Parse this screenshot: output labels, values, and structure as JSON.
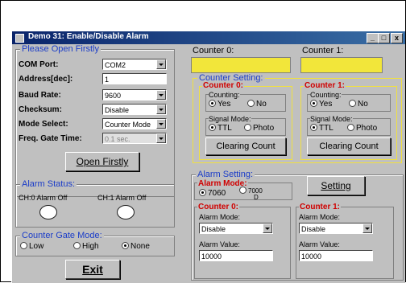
{
  "window": {
    "title": "Demo 31: Enable/Disable Alarm",
    "buttons": {
      "min": "_",
      "max": "□",
      "close": "x"
    }
  },
  "open_group": {
    "title": "Please Open Firstly",
    "com_port": {
      "label": "COM Port:",
      "value": "COM2"
    },
    "address": {
      "label": "Address[dec]:",
      "value": "1"
    },
    "baud_rate": {
      "label": "Baud Rate:",
      "value": "9600"
    },
    "checksum": {
      "label": "Checksum:",
      "value": "Disable"
    },
    "mode_select": {
      "label": "Mode Select:",
      "value": "Counter Mode"
    },
    "freq_gate": {
      "label": "Freq. Gate Time:",
      "value": "0.1 sec."
    },
    "open_button": "Open Firstly"
  },
  "alarm_status": {
    "title": "Alarm Status:",
    "ch0": "CH:0 Alarm Off",
    "ch1": "CH:1 Alarm Off"
  },
  "gate_mode": {
    "title": "Counter Gate Mode:",
    "options": [
      "Low",
      "High",
      "None"
    ],
    "selected": "None"
  },
  "exit_button": "Exit",
  "counters": {
    "counter0_label": "Counter 0:",
    "counter1_label": "Counter 1:",
    "counter_color": "#f2e63a"
  },
  "counter_setting": {
    "title": "Counter Setting:",
    "c0": {
      "title": "Counter 0:",
      "counting_label": "Counting:",
      "yes": "Yes",
      "no": "No",
      "signal_label": "Signal Mode:",
      "ttl": "TTL",
      "photo": "Photo",
      "clear": "Clearing Count"
    },
    "c1": {
      "title": "Counter 1:",
      "counting_label": "Counting:",
      "yes": "Yes",
      "no": "No",
      "signal_label": "Signal Mode:",
      "ttl": "TTL",
      "photo": "Photo",
      "clear": "Clearing Count"
    }
  },
  "alarm_setting": {
    "title": "Alarm Setting:",
    "alarm_mode_title": "Alarm Mode:",
    "mode_7060": "7060",
    "mode_7000": "7000",
    "mode_7000_suffix": "D",
    "setting_button": "Setting",
    "c0": {
      "title": "Counter 0:",
      "mode_label": "Alarm Mode:",
      "mode_value": "Disable",
      "value_label": "Alarm Value:",
      "value": "10000"
    },
    "c1": {
      "title": "Counter 1:",
      "mode_label": "Alarm Mode:",
      "mode_value": "Disable",
      "value_label": "Alarm Value:",
      "value": "10000"
    }
  },
  "colors": {
    "title_text": "#1a3cc8",
    "red_title": "#d00000",
    "highlight": "#f2e63a",
    "window": "#c0c0c0"
  }
}
